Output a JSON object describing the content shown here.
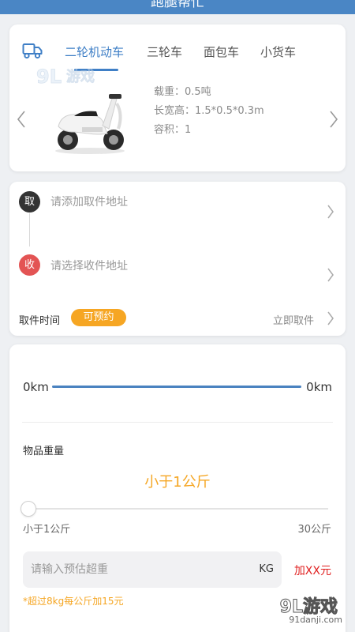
{
  "header": {
    "title": "跑腿帮忙"
  },
  "vehicle": {
    "tabs": [
      {
        "label": "二轮机动车",
        "active": true
      },
      {
        "label": "三轮车",
        "active": false
      },
      {
        "label": "面包车",
        "active": false
      },
      {
        "label": "小货车",
        "active": false
      }
    ],
    "specs": {
      "load": "载重：0.5吨",
      "dimensions": "长宽高：1.5*0.5*0.3m",
      "volume": "容积：1"
    }
  },
  "address": {
    "pickup_badge": "取",
    "pickup_placeholder": "请添加取件地址",
    "receive_badge": "收",
    "receive_placeholder": "请选择收件地址",
    "pickup_time_label": "取件时间",
    "reserve_label": "可预约",
    "immediate_label": "立即取件"
  },
  "distance": {
    "start": "0km",
    "end": "0km"
  },
  "weight": {
    "title": "物品重量",
    "value": "小于1公斤",
    "min_label": "小于1公斤",
    "max_label": "30公斤",
    "slider_level": 0,
    "overweight_placeholder": "请输入预估超重",
    "unit": "KG",
    "extra_fee": "加XX元",
    "note": "*超过8kg每公斤加15元"
  },
  "watermark": {
    "big": "9L游戏",
    "small": "91danji.com"
  },
  "colors": {
    "primary": "#3f7fc6",
    "accent": "#f5a623",
    "danger": "#e02020"
  }
}
